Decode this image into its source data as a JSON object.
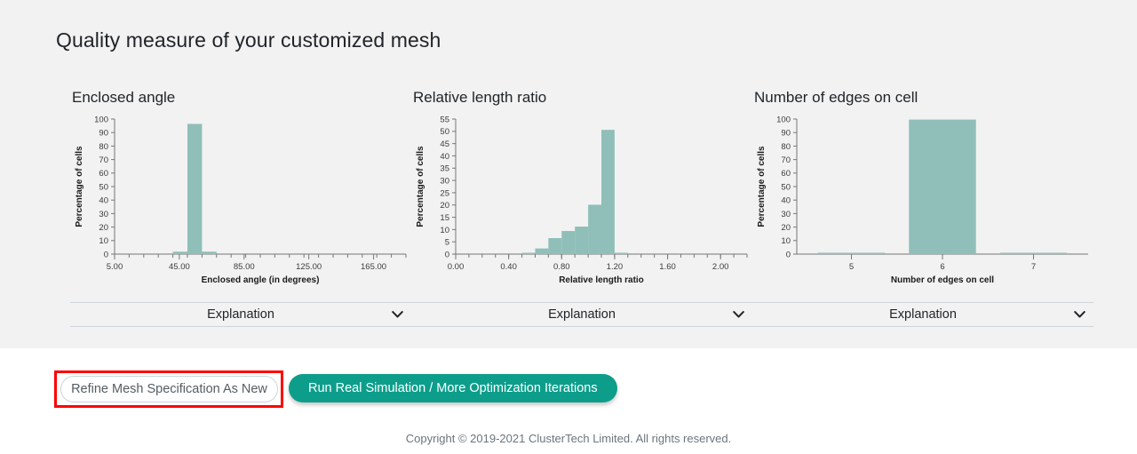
{
  "page": {
    "title": "Quality measure of your customized mesh",
    "background": "#f2f2f2",
    "accent": "#0d9e8b",
    "bar_color": "#8fbfb8",
    "highlight_color": "#ff0000"
  },
  "charts": [
    {
      "heading": "Enclosed angle",
      "select_label": "Explanation",
      "select_options": [
        "Explanation"
      ]
    },
    {
      "heading": "Relative length ratio",
      "select_label": "Explanation",
      "select_options": [
        "Explanation"
      ]
    },
    {
      "heading": "Number of edges on cell",
      "select_label": "Explanation",
      "select_options": [
        "Explanation"
      ]
    }
  ],
  "chart_data": [
    {
      "type": "bar",
      "title": "Enclosed angle",
      "xlabel": "Enclosed angle (in degrees)",
      "ylabel": "Percentage of cells",
      "xlim": [
        5,
        185
      ],
      "ylim": [
        0,
        100
      ],
      "ytick_values": [
        0,
        10,
        20,
        30,
        40,
        50,
        60,
        70,
        80,
        90,
        100
      ],
      "ytick_labels": [
        "0",
        "10",
        "20",
        "30",
        "40",
        "50",
        "60",
        "70",
        "80",
        "90",
        "100"
      ],
      "xtick_values": [
        5,
        45,
        85,
        125,
        165
      ],
      "xtick_labels": [
        "5.00",
        "45.00",
        "85.00",
        "125.00",
        "165.00"
      ],
      "bin_width": 9,
      "bins": [
        {
          "x0": 5,
          "x1": 14,
          "value": 0
        },
        {
          "x0": 14,
          "x1": 23,
          "value": 0
        },
        {
          "x0": 23,
          "x1": 32,
          "value": 0
        },
        {
          "x0": 32,
          "x1": 41,
          "value": 0
        },
        {
          "x0": 41,
          "x1": 50,
          "value": 1.8
        },
        {
          "x0": 50,
          "x1": 59,
          "value": 96.4
        },
        {
          "x0": 59,
          "x1": 68,
          "value": 1.8
        },
        {
          "x0": 68,
          "x1": 77,
          "value": 0
        },
        {
          "x0": 77,
          "x1": 86,
          "value": 0
        },
        {
          "x0": 86,
          "x1": 95,
          "value": 0
        },
        {
          "x0": 95,
          "x1": 104,
          "value": 0
        },
        {
          "x0": 104,
          "x1": 113,
          "value": 0
        },
        {
          "x0": 113,
          "x1": 122,
          "value": 0
        },
        {
          "x0": 122,
          "x1": 131,
          "value": 0
        },
        {
          "x0": 131,
          "x1": 140,
          "value": 0
        },
        {
          "x0": 140,
          "x1": 149,
          "value": 0
        },
        {
          "x0": 149,
          "x1": 158,
          "value": 0
        },
        {
          "x0": 158,
          "x1": 167,
          "value": 0
        },
        {
          "x0": 167,
          "x1": 176,
          "value": 0
        },
        {
          "x0": 176,
          "x1": 185,
          "value": 0
        }
      ]
    },
    {
      "type": "bar",
      "title": "Relative length ratio",
      "xlabel": "Relative length ratio",
      "ylabel": "Percentage of cells",
      "xlim": [
        0,
        2.2
      ],
      "ylim": [
        0,
        55
      ],
      "ytick_values": [
        0,
        5,
        10,
        15,
        20,
        25,
        30,
        35,
        40,
        45,
        50,
        55
      ],
      "ytick_labels": [
        "0",
        "5",
        "10",
        "15",
        "20",
        "25",
        "30",
        "35",
        "40",
        "45",
        "50",
        "55"
      ],
      "xtick_values": [
        0.0,
        0.4,
        0.8,
        1.2,
        1.6,
        2.0
      ],
      "xtick_labels": [
        "0.00",
        "0.40",
        "0.80",
        "1.20",
        "1.60",
        "2.00"
      ],
      "bin_width": 0.1,
      "bins": [
        {
          "x0": 0.0,
          "x1": 0.1,
          "value": 0
        },
        {
          "x0": 0.1,
          "x1": 0.2,
          "value": 0
        },
        {
          "x0": 0.2,
          "x1": 0.3,
          "value": 0
        },
        {
          "x0": 0.3,
          "x1": 0.4,
          "value": 0
        },
        {
          "x0": 0.4,
          "x1": 0.5,
          "value": 0
        },
        {
          "x0": 0.5,
          "x1": 0.6,
          "value": 0.4
        },
        {
          "x0": 0.6,
          "x1": 0.7,
          "value": 2.3
        },
        {
          "x0": 0.7,
          "x1": 0.8,
          "value": 6.5
        },
        {
          "x0": 0.8,
          "x1": 0.9,
          "value": 9.4
        },
        {
          "x0": 0.9,
          "x1": 1.0,
          "value": 11.2
        },
        {
          "x0": 1.0,
          "x1": 1.1,
          "value": 20.1
        },
        {
          "x0": 1.1,
          "x1": 1.2,
          "value": 50.6
        },
        {
          "x0": 1.2,
          "x1": 1.3,
          "value": 0.4
        },
        {
          "x0": 1.3,
          "x1": 1.4,
          "value": 0
        },
        {
          "x0": 1.4,
          "x1": 1.5,
          "value": 0
        },
        {
          "x0": 1.5,
          "x1": 1.6,
          "value": 0
        },
        {
          "x0": 1.6,
          "x1": 1.7,
          "value": 0
        },
        {
          "x0": 1.7,
          "x1": 1.8,
          "value": 0
        },
        {
          "x0": 1.8,
          "x1": 1.9,
          "value": 0
        },
        {
          "x0": 1.9,
          "x1": 2.0,
          "value": 0
        },
        {
          "x0": 2.0,
          "x1": 2.1,
          "value": 0
        },
        {
          "x0": 2.1,
          "x1": 2.2,
          "value": 0
        }
      ]
    },
    {
      "type": "bar",
      "title": "Number of edges on cell",
      "xlabel": "Number of edges on cell",
      "ylabel": "Percentage of cells",
      "xlim": [
        4.4,
        7.6
      ],
      "ylim": [
        0,
        100
      ],
      "ytick_values": [
        0,
        10,
        20,
        30,
        40,
        50,
        60,
        70,
        80,
        90,
        100
      ],
      "ytick_labels": [
        "0",
        "10",
        "20",
        "30",
        "40",
        "50",
        "60",
        "70",
        "80",
        "90",
        "100"
      ],
      "xtick_values": [
        5,
        6,
        7
      ],
      "xtick_labels": [
        "5",
        "6",
        "7"
      ],
      "categories": [
        "5",
        "6",
        "7"
      ],
      "values": [
        0.4,
        99.6,
        0.4
      ]
    }
  ],
  "actions": {
    "refine_label": "Refine Mesh Specification As New",
    "run_label": "Run Real Simulation / More Optimization Iterations"
  },
  "footer": {
    "copyright": "Copyright © 2019-2021 ClusterTech Limited. All rights reserved."
  }
}
